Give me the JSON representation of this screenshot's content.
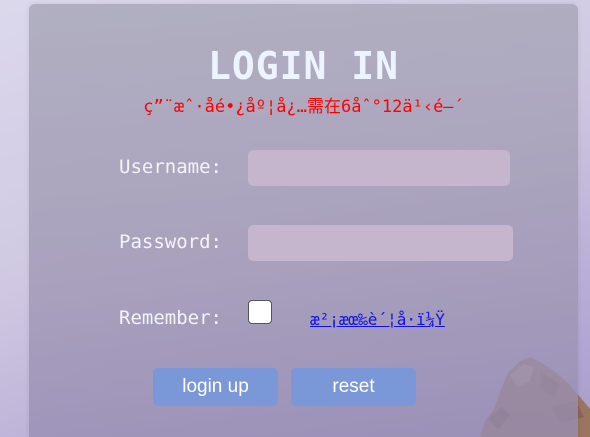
{
  "login": {
    "title": "LOGIN IN",
    "subtitle": "ç”¨æˆ·åé•¿åº¦å¿…需在6åˆ°12ä¹‹é—´",
    "username_label": "Username:",
    "username_value": "",
    "password_label": "Password:",
    "password_value": "",
    "remember_label": "Remember:",
    "remember_checked": false,
    "forgot_link": "æ²¡æœ‰è´¦å·ï¼Ÿ",
    "login_button": "login up",
    "reset_button": "reset"
  },
  "colors": {
    "title": "#eef4ff",
    "subtitle": "#ff0000",
    "input_bg": "#c5b5cd",
    "button_bg": "#7a98d8",
    "link": "#1010ee"
  }
}
